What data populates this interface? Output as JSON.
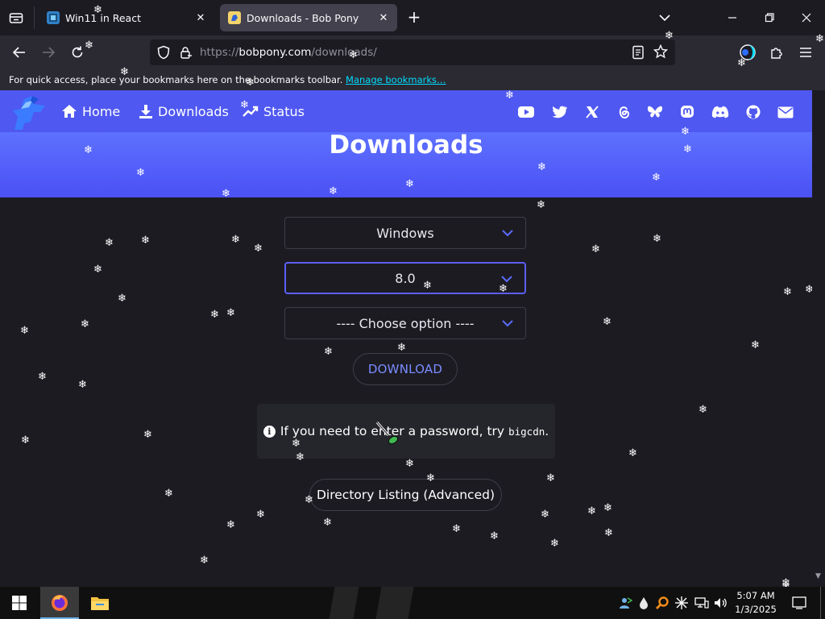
{
  "browser": {
    "tabs": [
      {
        "title": "Win11 in React",
        "favicon": "win11-favicon",
        "active": false
      },
      {
        "title": "Downloads - Bob Pony",
        "favicon": "bobpony-favicon",
        "active": true
      }
    ],
    "url_scheme": "https://",
    "url_host": "bobpony.com",
    "url_path": "/downloads/",
    "bookmarks_text": "For quick access, place your bookmarks here on the bookmarks toolbar.",
    "bookmarks_link": "Manage bookmarks…"
  },
  "site": {
    "nav": [
      {
        "label": "Home",
        "icon": "home-icon"
      },
      {
        "label": "Downloads",
        "icon": "download-icon"
      },
      {
        "label": "Status",
        "icon": "trend-icon"
      }
    ],
    "social_icons": [
      "youtube-icon",
      "twitter-icon",
      "x-icon",
      "threads-icon",
      "bluesky-icon",
      "mastodon-icon",
      "discord-icon",
      "github-icon",
      "email-icon"
    ],
    "page_title": "Downloads",
    "selects": [
      {
        "value": "Windows"
      },
      {
        "value": "8.0"
      },
      {
        "value": "---- Choose option ----"
      }
    ],
    "download_label": "DOWNLOAD",
    "info_text": "If you need to enter a password, try",
    "info_code": "bigcdn",
    "info_period": ".",
    "directory_label": "Directory Listing (Advanced)"
  },
  "taskbar": {
    "time": "5:07 AM",
    "date": "1/3/2025"
  },
  "colors": {
    "accent": "#5b5ff7",
    "hero_top": "#5d70ff",
    "hero_bottom": "#4b51f4",
    "link": "#00ddff",
    "page_bg": "#1c1b22"
  }
}
